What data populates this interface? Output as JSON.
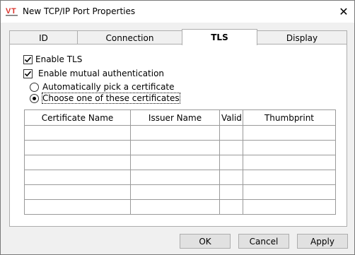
{
  "window": {
    "title": "New TCP/IP Port Properties",
    "app_icon": "vt-logo-icon",
    "close_glyph": "✕"
  },
  "tabs": [
    {
      "label": "ID",
      "active": false
    },
    {
      "label": "Connection",
      "active": false
    },
    {
      "label": "TLS",
      "active": true
    },
    {
      "label": "Display",
      "active": false
    }
  ],
  "tls": {
    "enable_tls": {
      "label": "Enable TLS",
      "checked": true
    },
    "mutual_auth": {
      "label": "Enable mutual authentication",
      "checked": true
    },
    "auto_pick": {
      "label": "Automatically pick a certificate",
      "selected": false
    },
    "choose_one": {
      "label": "Choose one of these certificates",
      "selected": true
    }
  },
  "cert_table": {
    "columns": [
      "Certificate Name",
      "Issuer Name",
      "Valid",
      "Thumbprint"
    ],
    "rows": [
      [
        "",
        "",
        "",
        ""
      ],
      [
        "",
        "",
        "",
        ""
      ],
      [
        "",
        "",
        "",
        ""
      ],
      [
        "",
        "",
        "",
        ""
      ],
      [
        "",
        "",
        "",
        ""
      ],
      [
        "",
        "",
        "",
        ""
      ]
    ]
  },
  "buttons": {
    "ok": "OK",
    "cancel": "Cancel",
    "apply": "Apply"
  },
  "colors": {
    "logo_red": "#d9322b",
    "logo_gray": "#6b6b6b"
  }
}
